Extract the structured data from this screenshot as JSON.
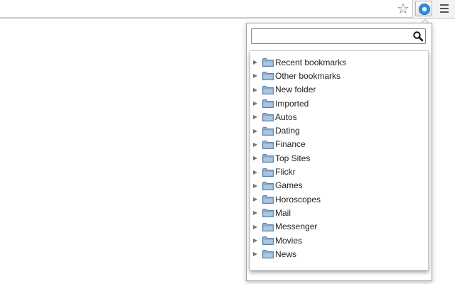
{
  "toolbar": {
    "star_icon": "star-outline-icon",
    "extension_icon": "bookmark-extension-icon",
    "menu_icon": "hamburger-menu-icon"
  },
  "popup": {
    "search": {
      "value": "",
      "placeholder": ""
    },
    "folders": [
      {
        "label": "Recent bookmarks"
      },
      {
        "label": "Other bookmarks"
      },
      {
        "label": "New folder"
      },
      {
        "label": "Imported"
      },
      {
        "label": "Autos"
      },
      {
        "label": "Dating"
      },
      {
        "label": "Finance"
      },
      {
        "label": "Top Sites"
      },
      {
        "label": "Flickr"
      },
      {
        "label": "Games"
      },
      {
        "label": "Horoscopes"
      },
      {
        "label": "Mail"
      },
      {
        "label": "Messenger"
      },
      {
        "label": "Movies"
      },
      {
        "label": "News"
      }
    ]
  },
  "colors": {
    "accent": "#2f8fe0",
    "folder": "#8fb3d6"
  }
}
